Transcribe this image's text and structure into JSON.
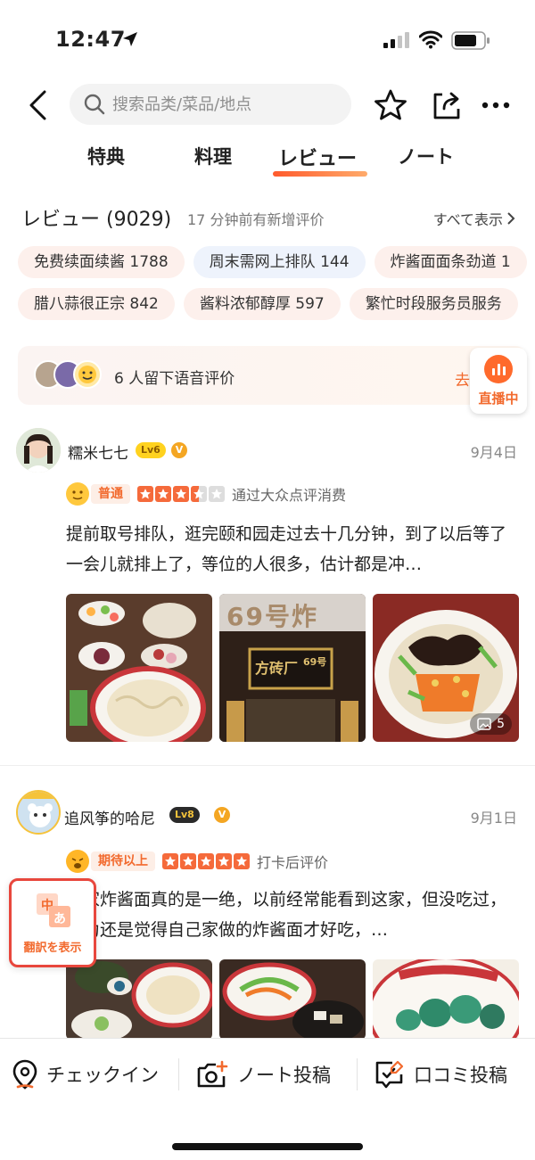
{
  "status_bar": {
    "time": "12:47"
  },
  "search": {
    "placeholder": "搜索品类/菜品/地点"
  },
  "tabs": [
    {
      "label": "特典"
    },
    {
      "label": "料理"
    },
    {
      "label": "レビュー"
    },
    {
      "label": "ノート"
    }
  ],
  "active_tab_index": 2,
  "review_section": {
    "title": "レビュー (9029)",
    "subtitle": "17 分钟前有新增评价",
    "see_all": "すべて表示"
  },
  "chips_row1": [
    {
      "label": "免费续面续酱 1788"
    },
    {
      "label": "周末需网上排队 144"
    },
    {
      "label": "炸酱面面条劲道 1"
    }
  ],
  "chips_row2": [
    {
      "label": "腊八蒜很正宗 842"
    },
    {
      "label": "酱料浓郁醇厚 597"
    },
    {
      "label": "繁忙时段服务员服务"
    }
  ],
  "voice_banner": {
    "text": "6 人留下语音评价",
    "listen": "去听听"
  },
  "live_badge": {
    "label": "直播中"
  },
  "reviews": [
    {
      "username": "糯米七七",
      "level": "Lv6",
      "date": "9月4日",
      "tag": "普通",
      "stars": 3.5,
      "rating_note": "通过大众点评消费",
      "text": "提前取号排队，逛完颐和园走过去十几分钟，到了以后等了一会儿就排上了，等位的人很多，估计都是冲…",
      "photo_count": "5"
    },
    {
      "username": "追风筝的哈尼",
      "level": "Lv8",
      "date": "9月1日",
      "tag": "期待以上",
      "stars": 5,
      "rating_note": "打卡后评价",
      "text": "这家炸酱面真的是一绝，以前经常能看到这家，但没吃过，因为还是觉得自己家做的炸酱面才好吃，…"
    }
  ],
  "photo_signs": {
    "sign1": "方砖厂",
    "sign2": "69号",
    "sign3": "69号炸"
  },
  "translate_button": {
    "label": "翻訳を表示"
  },
  "bottom_bar": {
    "checkin": "チェックイン",
    "note_post": "ノート投稿",
    "review_post": "口コミ投稿"
  },
  "colors": {
    "accent": "#f26a2e",
    "star": "#f56a3b",
    "chip_bg": "#fdf0ec"
  }
}
